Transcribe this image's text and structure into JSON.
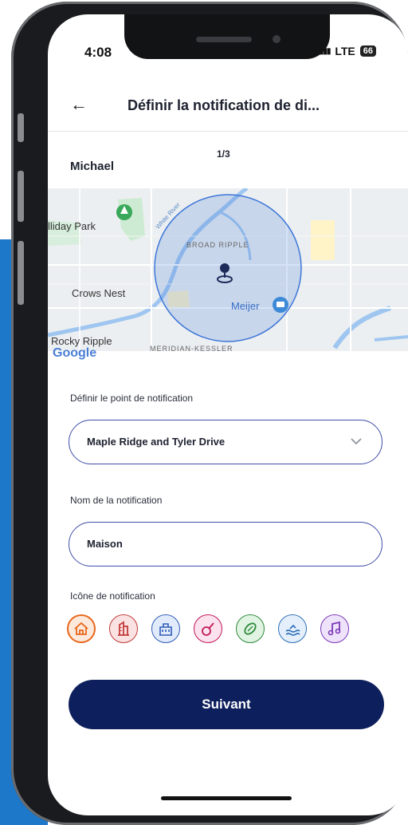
{
  "status": {
    "time": "4:08",
    "network": "LTE",
    "battery": "66"
  },
  "header": {
    "title": "Définir la notification de di..."
  },
  "step": "1/3",
  "member": "Michael",
  "map": {
    "labels": {
      "park": "lliday Park",
      "broad_ripple": "BROAD RIPPLE",
      "crows_nest": "Crows Nest",
      "meijer": "Meijer",
      "rocky_ripple": "Rocky Ripple",
      "meridian": "MERIDIAN-KESSLER",
      "river": "White River",
      "google": "Google"
    }
  },
  "form": {
    "point_label": "Définir le point de notification",
    "point_value": "Maple Ridge and  Tyler Drive",
    "name_label": "Nom de la notification",
    "name_value": "Maison",
    "icon_label": "Icône de notification"
  },
  "icons": [
    {
      "name": "home-icon",
      "color": "#e8671c",
      "bg": "#fde9dc",
      "selected": true
    },
    {
      "name": "building-icon",
      "color": "#c23a3a",
      "bg": "#fbe2e2",
      "selected": false
    },
    {
      "name": "school-icon",
      "color": "#2f5db8",
      "bg": "#e2ebfb",
      "selected": false
    },
    {
      "name": "guitar-icon",
      "color": "#c2185b",
      "bg": "#fbe2ec",
      "selected": false
    },
    {
      "name": "football-icon",
      "color": "#2e8b3c",
      "bg": "#e1f3e3",
      "selected": false
    },
    {
      "name": "swimming-icon",
      "color": "#2f6fb8",
      "bg": "#e4effb",
      "selected": false
    },
    {
      "name": "music-icon",
      "color": "#7b3ab8",
      "bg": "#efe3fb",
      "selected": false
    }
  ],
  "button": {
    "next_label": "Suivant"
  }
}
